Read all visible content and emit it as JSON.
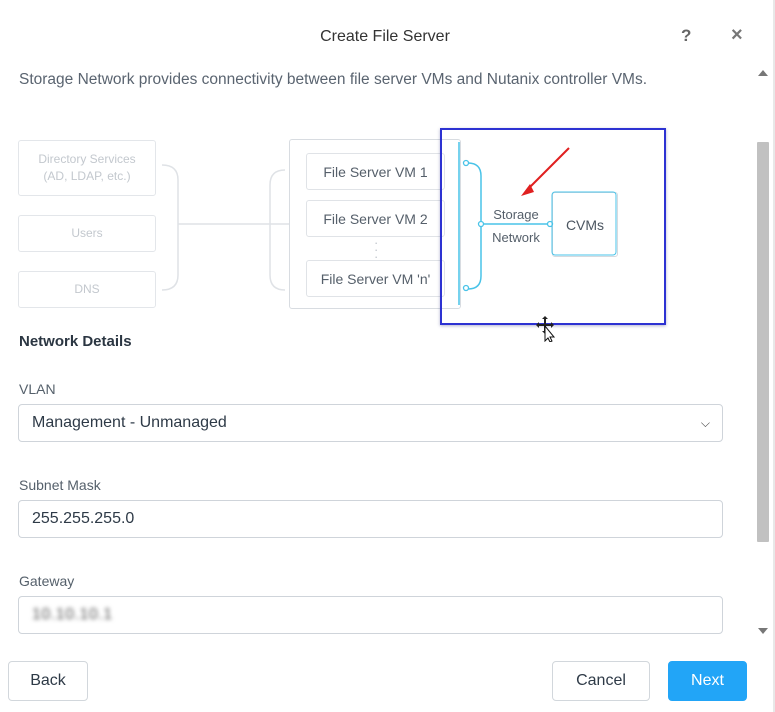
{
  "dialog": {
    "title": "Create File Server",
    "help_icon": "?",
    "close_icon": "×"
  },
  "description": "Storage Network provides connectivity between file server VMs and Nutanix controller VMs.",
  "diagram": {
    "left_boxes": [
      "Directory Services\n(AD, LDAP, etc.)",
      "Users",
      "DNS"
    ],
    "vm_boxes": [
      "File Server VM 1",
      "File Server VM 2",
      "File Server VM 'n'"
    ],
    "network_label_1": "Storage",
    "network_label_2": "Network",
    "cvms_label": "CVMs",
    "highlight_color": "#2d32d2",
    "annotation_arrow_color": "#e02020",
    "connector_color": "#49c3e8"
  },
  "network_details": {
    "heading": "Network Details",
    "vlan_label": "VLAN",
    "vlan_value": "Management - Unmanaged",
    "subnet_label": "Subnet Mask",
    "subnet_value": "255.255.255.0",
    "gateway_label": "Gateway",
    "gateway_value": "10.10.10.1"
  },
  "footer": {
    "back_label": "Back",
    "cancel_label": "Cancel",
    "next_label": "Next",
    "primary_color": "#22a5f7"
  }
}
